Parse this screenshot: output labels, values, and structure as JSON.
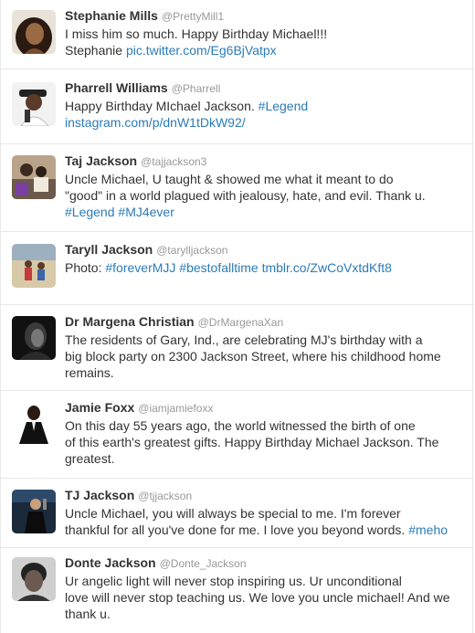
{
  "colors": {
    "link": "#2b7bb9",
    "name": "#333333",
    "handle": "#999999",
    "divider": "#e8e8e8"
  },
  "tweets": [
    {
      "name": "Stephanie Mills",
      "handle": "@PrettyMill1",
      "avatar": "stephanie-mills-avatar",
      "lines": [
        [
          {
            "t": "I miss him so much. Happy Birthday Michael!!!"
          }
        ],
        [
          {
            "t": "Stephanie "
          },
          {
            "t": "pic.twitter.com/Eg6BjVatpx",
            "link": true
          }
        ]
      ]
    },
    {
      "name": "Pharrell Williams",
      "handle": "@Pharrell",
      "avatar": "pharrell-williams-avatar",
      "lines": [
        [
          {
            "t": "Happy Birthday MIchael Jackson. "
          },
          {
            "t": "#Legend",
            "link": true
          }
        ],
        [
          {
            "t": "instagram.com/p/dnW1tDkW92/",
            "link": true
          }
        ]
      ]
    },
    {
      "name": "Taj Jackson",
      "handle": "@tajjackson3",
      "avatar": "taj-jackson-avatar",
      "lines": [
        [
          {
            "t": "Uncle Michael, U taught & showed me what it meant to do"
          }
        ],
        [
          {
            "t": "\"good\" in a world plagued with jealousy, hate, and evil. Thank u."
          }
        ],
        [
          {
            "t": "#Legend",
            "link": true
          },
          {
            "t": " "
          },
          {
            "t": "#MJ4ever",
            "link": true
          }
        ]
      ]
    },
    {
      "name": "Taryll Jackson",
      "handle": "@tarylljackson",
      "avatar": "taryll-jackson-avatar",
      "lines": [
        [
          {
            "t": "Photo: "
          },
          {
            "t": "#foreverMJJ",
            "link": true
          },
          {
            "t": " "
          },
          {
            "t": "#bestofalltime",
            "link": true
          },
          {
            "t": " "
          },
          {
            "t": "tmblr.co/ZwCoVxtdKft8",
            "link": true
          }
        ]
      ]
    },
    {
      "name": "Dr Margena Christian",
      "handle": "@DrMargenaXan",
      "avatar": "margena-christian-avatar",
      "lines": [
        [
          {
            "t": "The residents of Gary, Ind., are celebrating MJ's birthday with a"
          }
        ],
        [
          {
            "t": "big block party on 2300 Jackson Street, where his childhood home"
          }
        ],
        [
          {
            "t": "remains."
          }
        ]
      ]
    },
    {
      "name": "Jamie Foxx",
      "handle": "@iamjamiefoxx",
      "avatar": "jamie-foxx-avatar",
      "lines": [
        [
          {
            "t": "On this day 55 years ago, the world witnessed the birth of one"
          }
        ],
        [
          {
            "t": "of this earth's greatest gifts. Happy Birthday Michael Jackson. The"
          }
        ],
        [
          {
            "t": "greatest."
          }
        ]
      ]
    },
    {
      "name": "TJ Jackson",
      "handle": "@tjjackson",
      "avatar": "tj-jackson-avatar",
      "lines": [
        [
          {
            "t": "Uncle Michael, you will always be special to me. I'm forever"
          }
        ],
        [
          {
            "t": "thankful for all you've done for me. I love you beyond words. "
          },
          {
            "t": "#meho",
            "link": true
          }
        ]
      ]
    },
    {
      "name": "Donte Jackson",
      "handle": "@Donte_Jackson",
      "avatar": "donte-jackson-avatar",
      "lines": [
        [
          {
            "t": "Ur angelic light will never stop inspiring us. Ur unconditional"
          }
        ],
        [
          {
            "t": "love will never stop teaching us. We love you uncle michael! And we"
          }
        ],
        [
          {
            "t": "thank u."
          }
        ]
      ]
    }
  ]
}
